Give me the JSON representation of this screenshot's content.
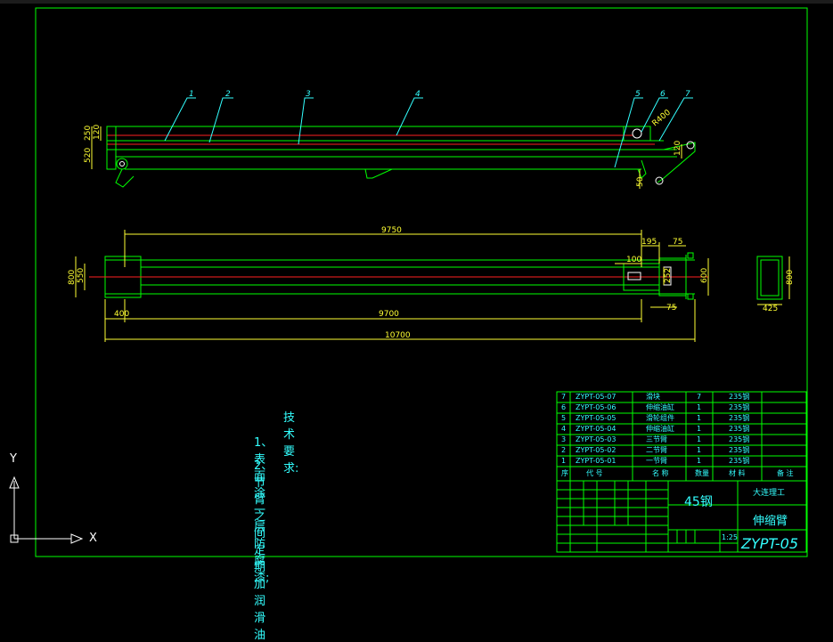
{
  "balloons": [
    "1",
    "2",
    "3",
    "4",
    "5",
    "6",
    "7"
  ],
  "side_view_dims": {
    "d250": "250",
    "d120": "120",
    "d520": "520",
    "r400": "R400",
    "d50": "50",
    "d120b": "120"
  },
  "top_view_dims": {
    "d9750": "9750",
    "d195": "195",
    "d75a": "75",
    "d800": "800",
    "d550": "550",
    "d100": "100",
    "d600": "600",
    "d400": "400",
    "d9700": "9700",
    "d75b": "75",
    "d10700": "10700",
    "d252": "252"
  },
  "section_dims": {
    "d800": "800",
    "d425": "425"
  },
  "tech_notes": {
    "title": "技术要求:",
    "lines": [
      "1、表面涂一层防腐漆;",
      "2、节臂之间定期加润滑油"
    ]
  },
  "bom": {
    "rows": [
      {
        "no": "7",
        "code": "ZYPT-05-07",
        "name": "滑块",
        "qty": "7",
        "material": "235钢"
      },
      {
        "no": "6",
        "code": "ZYPT-05-06",
        "name": "伸缩油缸",
        "qty": "1",
        "material": "235钢"
      },
      {
        "no": "5",
        "code": "ZYPT-05-05",
        "name": "滑轮组件",
        "qty": "1",
        "material": "235钢"
      },
      {
        "no": "4",
        "code": "ZYPT-05-04",
        "name": "伸缩油缸",
        "qty": "1",
        "material": "235钢"
      },
      {
        "no": "3",
        "code": "ZYPT-05-03",
        "name": "三节臂",
        "qty": "1",
        "material": "235钢"
      },
      {
        "no": "2",
        "code": "ZYPT-05-02",
        "name": "二节臂",
        "qty": "1",
        "material": "235钢"
      },
      {
        "no": "1",
        "code": "ZYPT-05-01",
        "name": "一节臂",
        "qty": "1",
        "material": "235钢"
      }
    ],
    "header": {
      "no": "序",
      "code": "代 号",
      "name": "名 称",
      "qty": "数量",
      "material": "材 料",
      "remark": "备 注"
    }
  },
  "title_block": {
    "material": "45钢",
    "company": "大连理工",
    "part_name": "伸缩臂",
    "scale": "1:25",
    "drawing_no": "ZYPT-05"
  },
  "ucs": {
    "x": "X",
    "y": "Y"
  },
  "colors": {
    "green": "#00ff00",
    "cyan": "#33ffff",
    "red": "#ff2020",
    "yellow": "#ffff33",
    "white": "#ffffff"
  }
}
